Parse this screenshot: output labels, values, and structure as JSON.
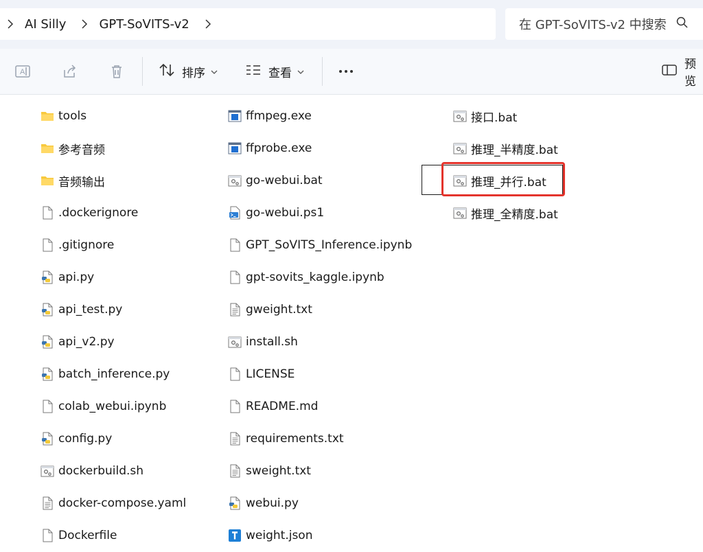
{
  "breadcrumb": {
    "items": [
      "AI Silly",
      "GPT-SoVITS-v2"
    ]
  },
  "search": {
    "placeholder": "在 GPT-SoVITS-v2 中搜索"
  },
  "toolbar": {
    "sort_label": "排序",
    "view_label": "查看",
    "preview_label": "预览"
  },
  "files": {
    "col1": [
      {
        "name": "tools",
        "icon": "folder"
      },
      {
        "name": "参考音频",
        "icon": "folder"
      },
      {
        "name": "音频输出",
        "icon": "folder"
      },
      {
        "name": ".dockerignore",
        "icon": "file"
      },
      {
        "name": ".gitignore",
        "icon": "file"
      },
      {
        "name": "api.py",
        "icon": "python"
      },
      {
        "name": "api_test.py",
        "icon": "python"
      },
      {
        "name": "api_v2.py",
        "icon": "python"
      },
      {
        "name": "batch_inference.py",
        "icon": "python"
      },
      {
        "name": "colab_webui.ipynb",
        "icon": "file"
      },
      {
        "name": "config.py",
        "icon": "python"
      },
      {
        "name": "dockerbuild.sh",
        "icon": "script"
      },
      {
        "name": "docker-compose.yaml",
        "icon": "text"
      },
      {
        "name": "Dockerfile",
        "icon": "file"
      }
    ],
    "col2": [
      {
        "name": "ffmpeg.exe",
        "icon": "exe"
      },
      {
        "name": "ffprobe.exe",
        "icon": "exe"
      },
      {
        "name": "go-webui.bat",
        "icon": "script"
      },
      {
        "name": "go-webui.ps1",
        "icon": "ps1"
      },
      {
        "name": "GPT_SoVITS_Inference.ipynb",
        "icon": "file"
      },
      {
        "name": "gpt-sovits_kaggle.ipynb",
        "icon": "file"
      },
      {
        "name": "gweight.txt",
        "icon": "text"
      },
      {
        "name": "install.sh",
        "icon": "script"
      },
      {
        "name": "LICENSE",
        "icon": "file"
      },
      {
        "name": "README.md",
        "icon": "file"
      },
      {
        "name": "requirements.txt",
        "icon": "text"
      },
      {
        "name": "sweight.txt",
        "icon": "text"
      },
      {
        "name": "webui.py",
        "icon": "python"
      },
      {
        "name": "weight.json",
        "icon": "json"
      }
    ],
    "col3": [
      {
        "name": "接口.bat",
        "icon": "script"
      },
      {
        "name": "推理_半精度.bat",
        "icon": "script"
      },
      {
        "name": "推理_并行.bat",
        "icon": "script"
      },
      {
        "name": "推理_全精度.bat",
        "icon": "script"
      }
    ]
  },
  "highlight": {
    "color": "#e4342c"
  }
}
